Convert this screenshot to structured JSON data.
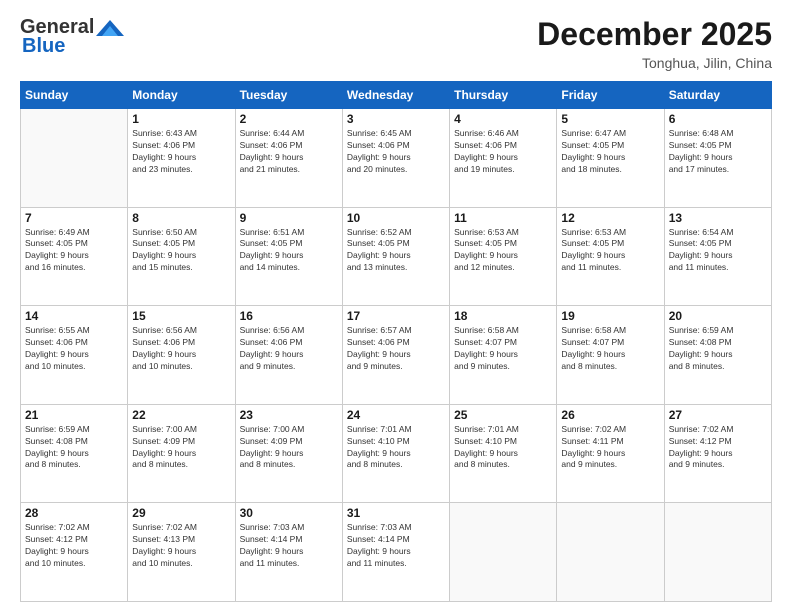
{
  "header": {
    "logo_general": "General",
    "logo_blue": "Blue",
    "title": "December 2025",
    "location": "Tonghua, Jilin, China"
  },
  "calendar": {
    "days_of_week": [
      "Sunday",
      "Monday",
      "Tuesday",
      "Wednesday",
      "Thursday",
      "Friday",
      "Saturday"
    ],
    "weeks": [
      [
        {
          "day": "",
          "info": ""
        },
        {
          "day": "1",
          "info": "Sunrise: 6:43 AM\nSunset: 4:06 PM\nDaylight: 9 hours\nand 23 minutes."
        },
        {
          "day": "2",
          "info": "Sunrise: 6:44 AM\nSunset: 4:06 PM\nDaylight: 9 hours\nand 21 minutes."
        },
        {
          "day": "3",
          "info": "Sunrise: 6:45 AM\nSunset: 4:06 PM\nDaylight: 9 hours\nand 20 minutes."
        },
        {
          "day": "4",
          "info": "Sunrise: 6:46 AM\nSunset: 4:06 PM\nDaylight: 9 hours\nand 19 minutes."
        },
        {
          "day": "5",
          "info": "Sunrise: 6:47 AM\nSunset: 4:05 PM\nDaylight: 9 hours\nand 18 minutes."
        },
        {
          "day": "6",
          "info": "Sunrise: 6:48 AM\nSunset: 4:05 PM\nDaylight: 9 hours\nand 17 minutes."
        }
      ],
      [
        {
          "day": "7",
          "info": "Sunrise: 6:49 AM\nSunset: 4:05 PM\nDaylight: 9 hours\nand 16 minutes."
        },
        {
          "day": "8",
          "info": "Sunrise: 6:50 AM\nSunset: 4:05 PM\nDaylight: 9 hours\nand 15 minutes."
        },
        {
          "day": "9",
          "info": "Sunrise: 6:51 AM\nSunset: 4:05 PM\nDaylight: 9 hours\nand 14 minutes."
        },
        {
          "day": "10",
          "info": "Sunrise: 6:52 AM\nSunset: 4:05 PM\nDaylight: 9 hours\nand 13 minutes."
        },
        {
          "day": "11",
          "info": "Sunrise: 6:53 AM\nSunset: 4:05 PM\nDaylight: 9 hours\nand 12 minutes."
        },
        {
          "day": "12",
          "info": "Sunrise: 6:53 AM\nSunset: 4:05 PM\nDaylight: 9 hours\nand 11 minutes."
        },
        {
          "day": "13",
          "info": "Sunrise: 6:54 AM\nSunset: 4:05 PM\nDaylight: 9 hours\nand 11 minutes."
        }
      ],
      [
        {
          "day": "14",
          "info": "Sunrise: 6:55 AM\nSunset: 4:06 PM\nDaylight: 9 hours\nand 10 minutes."
        },
        {
          "day": "15",
          "info": "Sunrise: 6:56 AM\nSunset: 4:06 PM\nDaylight: 9 hours\nand 10 minutes."
        },
        {
          "day": "16",
          "info": "Sunrise: 6:56 AM\nSunset: 4:06 PM\nDaylight: 9 hours\nand 9 minutes."
        },
        {
          "day": "17",
          "info": "Sunrise: 6:57 AM\nSunset: 4:06 PM\nDaylight: 9 hours\nand 9 minutes."
        },
        {
          "day": "18",
          "info": "Sunrise: 6:58 AM\nSunset: 4:07 PM\nDaylight: 9 hours\nand 9 minutes."
        },
        {
          "day": "19",
          "info": "Sunrise: 6:58 AM\nSunset: 4:07 PM\nDaylight: 9 hours\nand 8 minutes."
        },
        {
          "day": "20",
          "info": "Sunrise: 6:59 AM\nSunset: 4:08 PM\nDaylight: 9 hours\nand 8 minutes."
        }
      ],
      [
        {
          "day": "21",
          "info": "Sunrise: 6:59 AM\nSunset: 4:08 PM\nDaylight: 9 hours\nand 8 minutes."
        },
        {
          "day": "22",
          "info": "Sunrise: 7:00 AM\nSunset: 4:09 PM\nDaylight: 9 hours\nand 8 minutes."
        },
        {
          "day": "23",
          "info": "Sunrise: 7:00 AM\nSunset: 4:09 PM\nDaylight: 9 hours\nand 8 minutes."
        },
        {
          "day": "24",
          "info": "Sunrise: 7:01 AM\nSunset: 4:10 PM\nDaylight: 9 hours\nand 8 minutes."
        },
        {
          "day": "25",
          "info": "Sunrise: 7:01 AM\nSunset: 4:10 PM\nDaylight: 9 hours\nand 8 minutes."
        },
        {
          "day": "26",
          "info": "Sunrise: 7:02 AM\nSunset: 4:11 PM\nDaylight: 9 hours\nand 9 minutes."
        },
        {
          "day": "27",
          "info": "Sunrise: 7:02 AM\nSunset: 4:12 PM\nDaylight: 9 hours\nand 9 minutes."
        }
      ],
      [
        {
          "day": "28",
          "info": "Sunrise: 7:02 AM\nSunset: 4:12 PM\nDaylight: 9 hours\nand 10 minutes."
        },
        {
          "day": "29",
          "info": "Sunrise: 7:02 AM\nSunset: 4:13 PM\nDaylight: 9 hours\nand 10 minutes."
        },
        {
          "day": "30",
          "info": "Sunrise: 7:03 AM\nSunset: 4:14 PM\nDaylight: 9 hours\nand 11 minutes."
        },
        {
          "day": "31",
          "info": "Sunrise: 7:03 AM\nSunset: 4:14 PM\nDaylight: 9 hours\nand 11 minutes."
        },
        {
          "day": "",
          "info": ""
        },
        {
          "day": "",
          "info": ""
        },
        {
          "day": "",
          "info": ""
        }
      ]
    ]
  }
}
